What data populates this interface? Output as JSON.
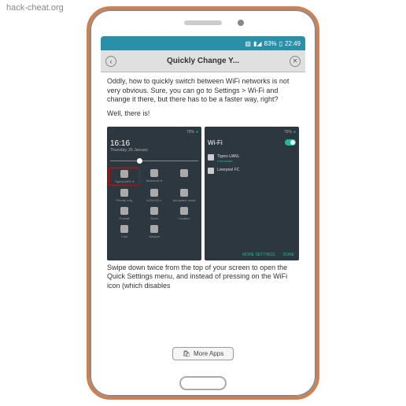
{
  "watermark": "hack-cheat.org",
  "status": {
    "battery": "83%",
    "time": "22:49",
    "icons": [
      "N",
      "signal",
      "wifi"
    ]
  },
  "header": {
    "title": "Quickly Change Y..."
  },
  "article": {
    "p1": "Oddly, how to quickly switch between WiFi networks is not very obvious. Sure, you can go to Settings > Wi-Fi and change it there, but there has to be a faster way, right?",
    "p2": "Well, there is!",
    "p3": "Swipe down twice from the top of your screen to open the Quick Settings menu, and instead of pressing on the WiFi icon (which disables"
  },
  "shot_left": {
    "status_pct": "79%",
    "time": "16:16",
    "date": "Thursday, 26 January",
    "tiles": [
      {
        "label": "TigresUANL",
        "highlight": true
      },
      {
        "label": "Bluetooth"
      },
      {
        "label": ""
      },
      {
        "label": "Priority only"
      },
      {
        "label": "IUSACELL"
      },
      {
        "label": "Aeroplane mode"
      },
      {
        "label": "Portrait"
      },
      {
        "label": "Torch"
      },
      {
        "label": "Location"
      },
      {
        "label": "Cast"
      },
      {
        "label": "Hotspot"
      },
      {
        "label": ""
      }
    ]
  },
  "shot_right": {
    "status_pct": "79%",
    "title": "Wi-Fi",
    "networks": [
      {
        "name": "Tigres UANL",
        "sub": "Connected"
      },
      {
        "name": "Liverpool FC",
        "sub": ""
      }
    ],
    "footer": {
      "more": "MORE SETTINGS",
      "done": "DONE"
    }
  },
  "more_apps": "More Apps"
}
